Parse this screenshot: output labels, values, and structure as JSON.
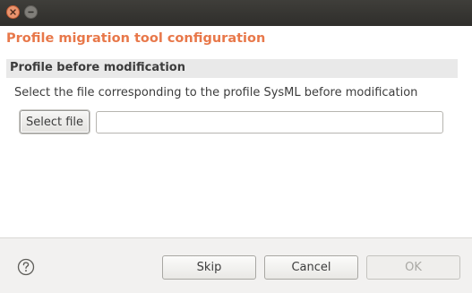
{
  "window": {
    "buttons": {
      "close_icon": "close-icon",
      "minimize_icon": "minimize-icon"
    }
  },
  "header": {
    "title": "Profile migration tool configuration",
    "title_color": "#e8784a"
  },
  "section": {
    "title": "Profile before modification",
    "description": "Select the file corresponding to the profile SysML before modification",
    "select_file_label": "Select file",
    "file_path_value": "",
    "file_path_placeholder": ""
  },
  "footer": {
    "help_icon": "help-icon",
    "skip_label": "Skip",
    "cancel_label": "Cancel",
    "ok_label": "OK",
    "ok_enabled": false
  }
}
